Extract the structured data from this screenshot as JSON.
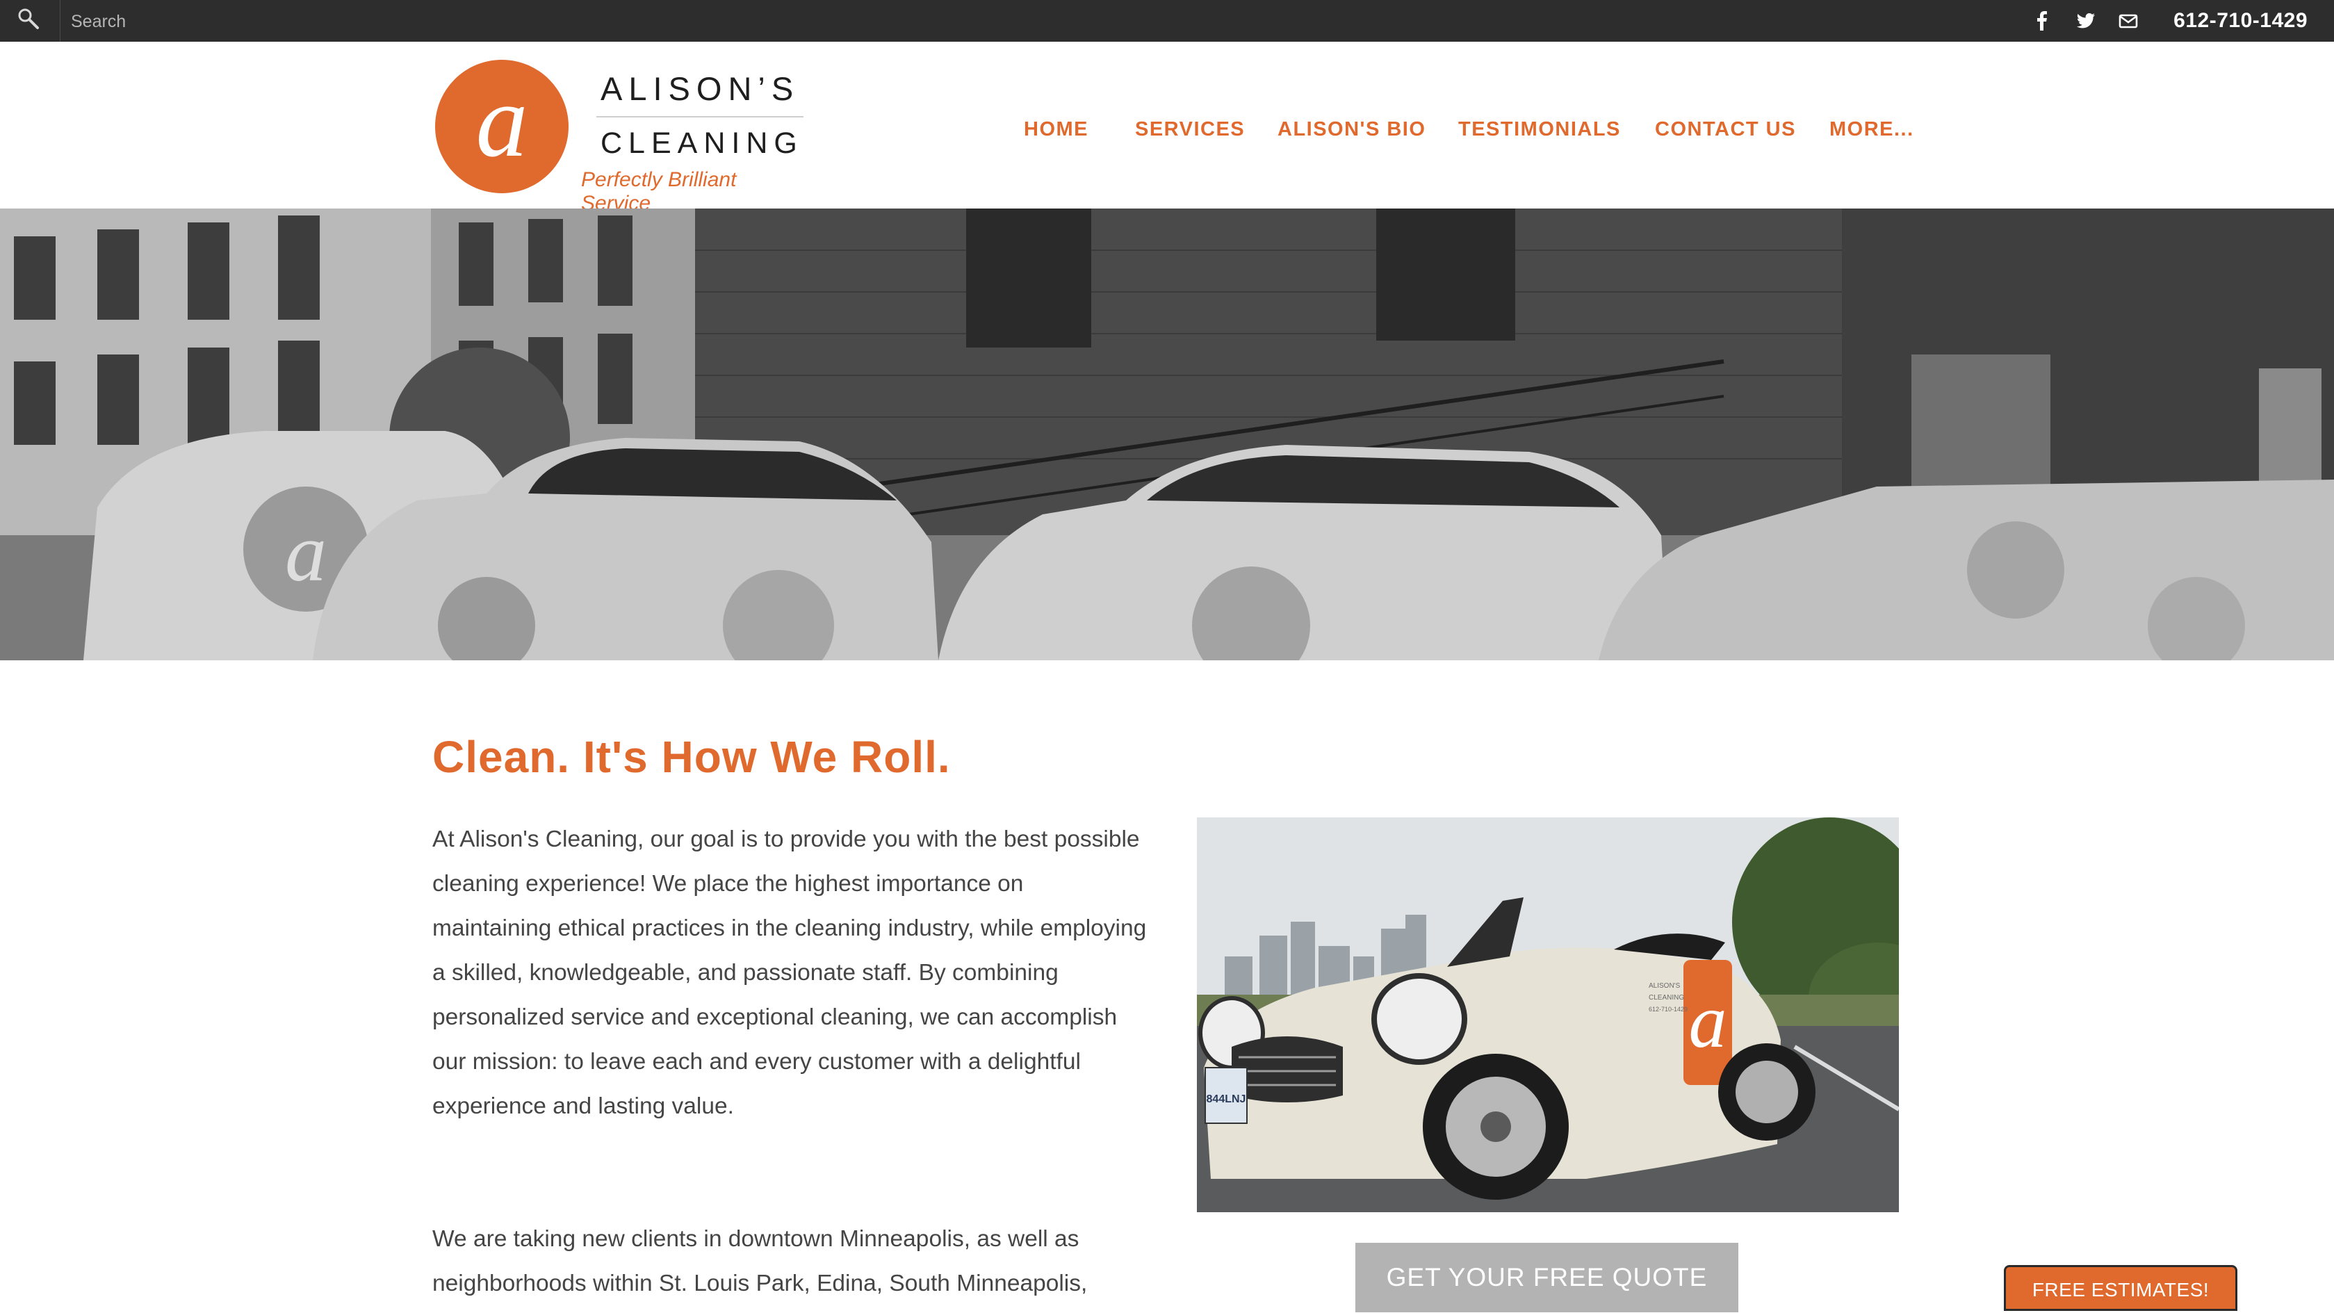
{
  "topbar": {
    "search_placeholder": "Search",
    "search_icon": "search-icon",
    "social_icons": [
      "facebook-icon",
      "twitter-icon",
      "mail-icon"
    ],
    "phone": "612-710-1429"
  },
  "logo": {
    "brand_line1": "ALISON’S",
    "brand_line2": "CLEANING",
    "tagline": "Perfectly Brilliant Service",
    "monogram": "a"
  },
  "nav": {
    "items": [
      {
        "label": "HOME"
      },
      {
        "label": "SERVICES"
      },
      {
        "label": "ALISON'S BIO"
      },
      {
        "label": "TESTIMONIALS"
      },
      {
        "label": "CONTACT US"
      },
      {
        "label": "MORE..."
      }
    ]
  },
  "main": {
    "headline": "Clean.  It's How We Roll.",
    "paragraph1": "At Alison's Cleaning, our goal is to provide you with the best possible cleaning experience! We place the highest importance on maintaining ethical practices in the cleaning industry, while employing a skilled, knowledgeable, and passionate staff. By combining personalized service and exceptional cleaning, we can accomplish our mission: to leave each and every customer with a delightful experience and lasting value.",
    "paragraph2": "We are taking new clients in downtown Minneapolis, as well as neighborhoods within St. Louis Park, Edina, South Minneapolis,",
    "quote_button": "GET YOUR FREE QUOTE",
    "car_sign": [
      "ALISON'S",
      "CLEANING",
      "612-710-1429"
    ],
    "plate": "844LNJ"
  },
  "floating": {
    "estimates_button": "FREE ESTIMATES!"
  },
  "colors": {
    "accent": "#e0692d",
    "topbar": "#2d2d2d",
    "button_gray": "#b3b3b3"
  }
}
